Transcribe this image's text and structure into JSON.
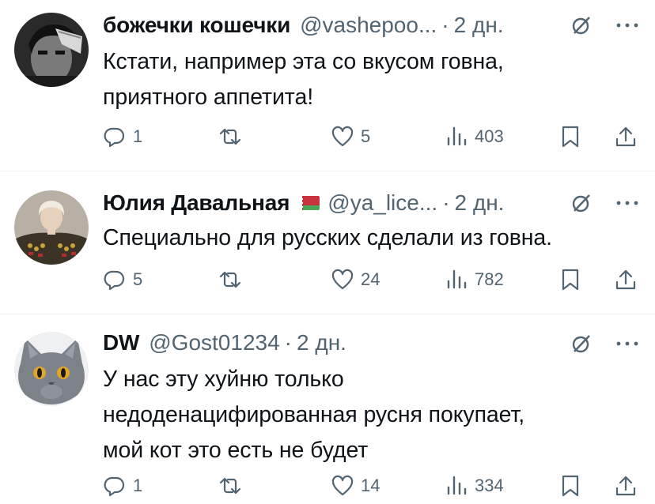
{
  "tweets": [
    {
      "name": "божечки кошечки",
      "handle": "@vashepoo...",
      "dot": "·",
      "time": "2 дн.",
      "lines": [
        "Кстати, например эта со вкусом говна,",
        "приятного аппетита!"
      ],
      "replies": "1",
      "likes": "5",
      "views": "403"
    },
    {
      "name": "Юлия Давальная",
      "has_flag": true,
      "handle": "@ya_lice...",
      "dot": "·",
      "time": "2 дн.",
      "lines": [
        "Специально для русских сделали из говна."
      ],
      "replies": "5",
      "likes": "24",
      "views": "782"
    },
    {
      "name": "DW",
      "handle": "@Gost01234",
      "dot": "·",
      "time": "2 дн.",
      "lines": [
        "У нас эту хуйню только",
        "недоденацифированная русня покупает,",
        "мой кот это есть не будет"
      ],
      "replies": "1",
      "likes": "14",
      "views": "334"
    }
  ],
  "icons": {
    "reply": "reply-icon",
    "retweet": "retweet-icon",
    "like": "heart-icon",
    "views": "views-icon",
    "bookmark": "bookmark-icon",
    "share": "share-icon",
    "grok": "grok-icon",
    "more": "more-icon"
  },
  "colors": {
    "text": "#0f1419",
    "secondary": "#536471",
    "divider": "#eff3f4",
    "flag_red": "#c8313e",
    "flag_green": "#4aa657"
  }
}
